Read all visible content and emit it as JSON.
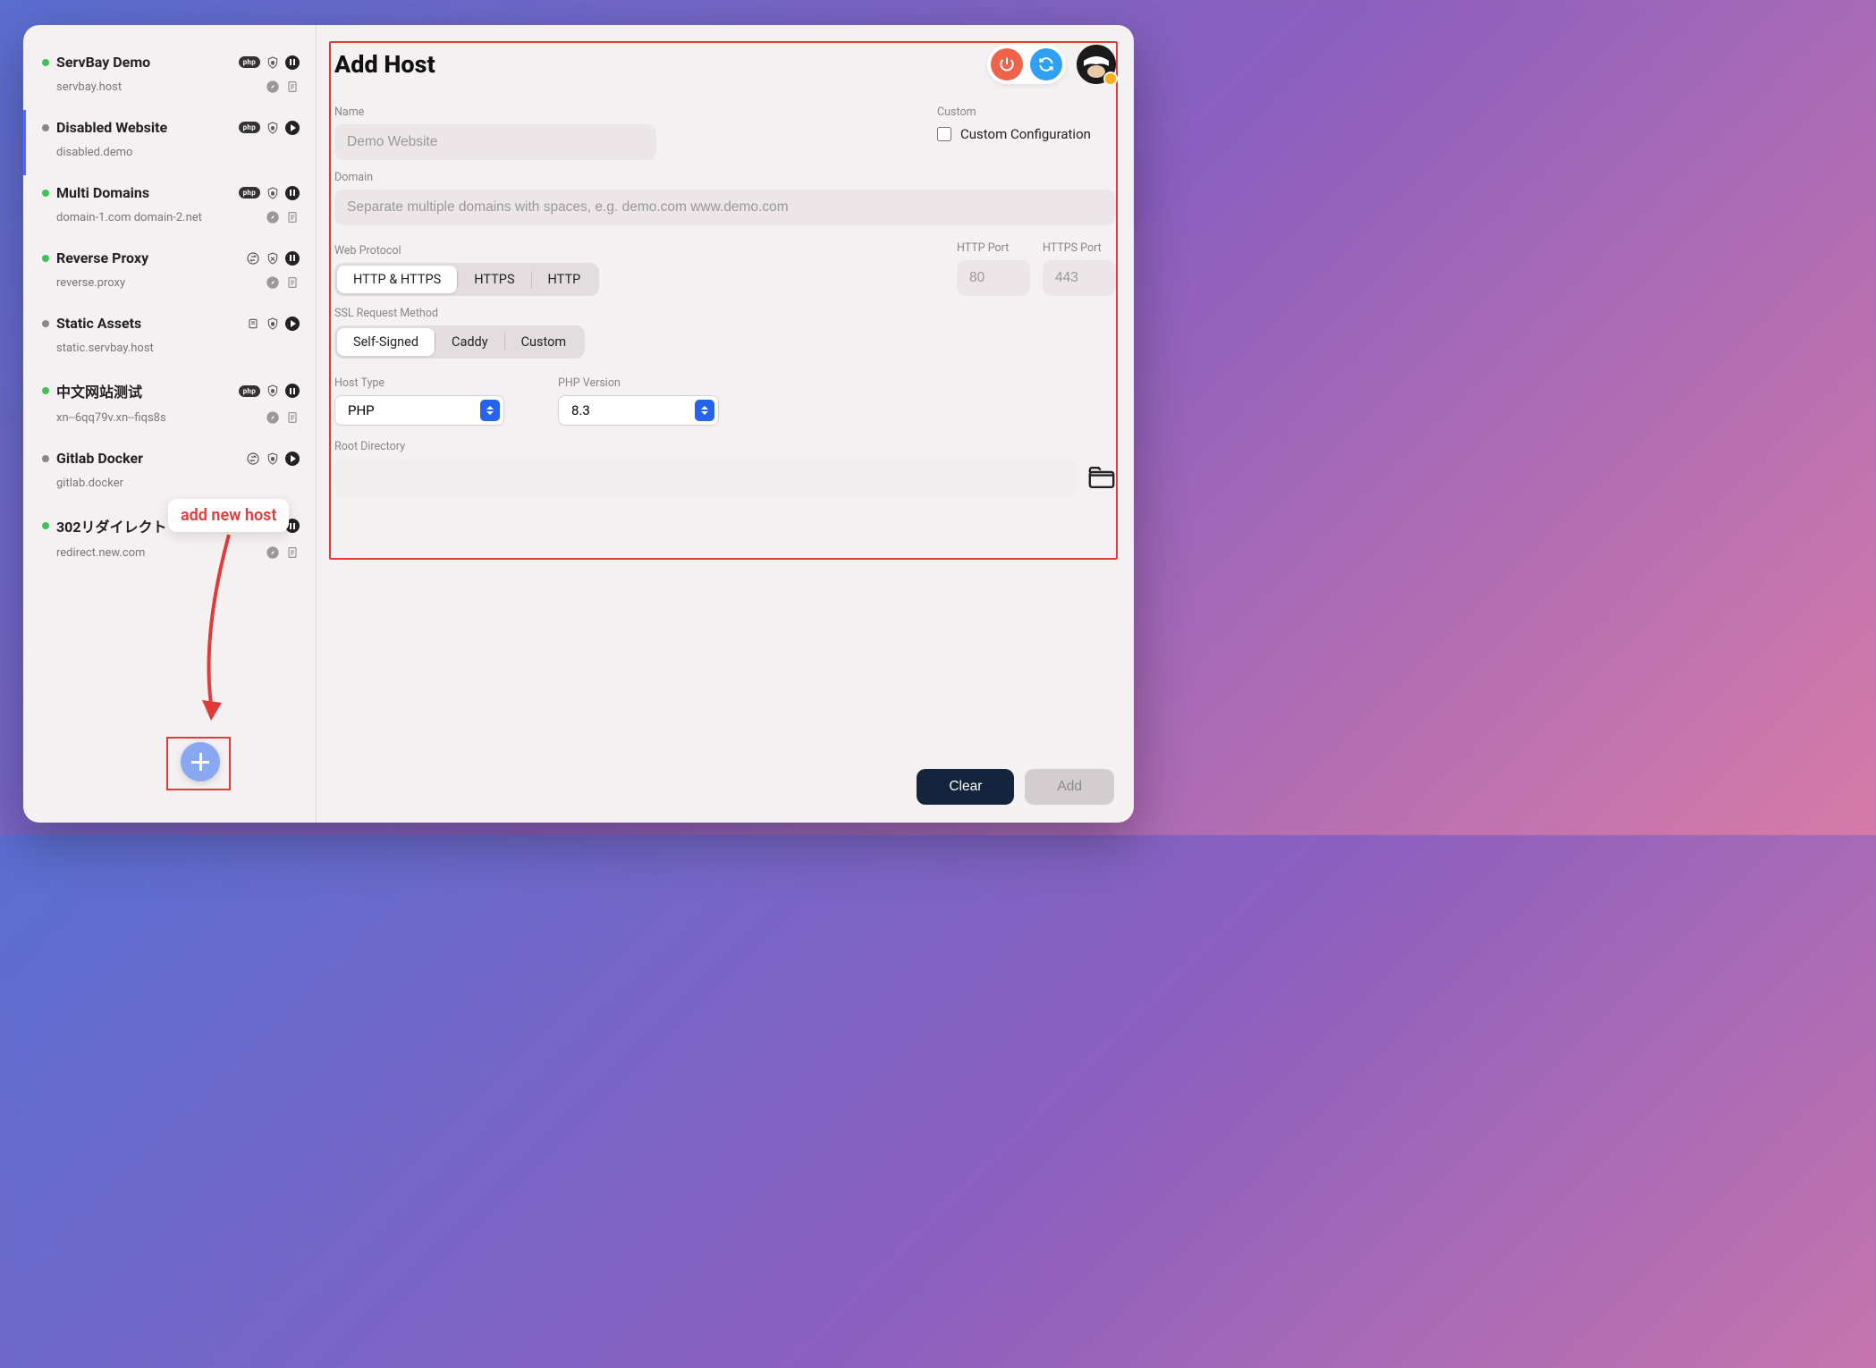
{
  "annotation": {
    "tooltip": "add new host"
  },
  "sidebar": {
    "items": [
      {
        "name": "ServBay Demo",
        "domain": "servbay.host",
        "status": "green",
        "tag": "php",
        "shield": "lock",
        "action": "pause",
        "row2a": "compass",
        "row2b": "doc"
      },
      {
        "name": "Disabled Website",
        "domain": "disabled.demo",
        "status": "grey",
        "tag": "php",
        "shield": "lock",
        "action": "play",
        "row2a": "blank",
        "row2b": "blank",
        "selected": true
      },
      {
        "name": "Multi Domains",
        "domain": "domain-1.com domain-2.net",
        "status": "green",
        "tag": "php",
        "shield": "lock",
        "action": "pause",
        "row2a": "compass",
        "row2b": "doc"
      },
      {
        "name": "Reverse Proxy",
        "domain": "reverse.proxy",
        "status": "green",
        "tag": "swap",
        "shield": "x",
        "action": "pause",
        "row2a": "compass",
        "row2b": "doc"
      },
      {
        "name": "Static Assets",
        "domain": "static.servbay.host",
        "status": "grey",
        "tag": "layers",
        "shield": "lock",
        "action": "play",
        "row2a": "blank",
        "row2b": "blank"
      },
      {
        "name": "中文网站测试",
        "domain": "xn--6qq79v.xn--fiqs8s",
        "status": "green",
        "tag": "php",
        "shield": "lock",
        "action": "pause",
        "row2a": "compass",
        "row2b": "doc"
      },
      {
        "name": "Gitlab Docker",
        "domain": "gitlab.docker",
        "status": "grey",
        "tag": "swap",
        "shield": "lock",
        "action": "play",
        "row2a": "blank",
        "row2b": "blank"
      },
      {
        "name": "302リダイレクト",
        "domain": "redirect.new.com",
        "status": "green",
        "tag": "redirect",
        "shield": "lock",
        "action": "pause",
        "row2a": "compass",
        "row2b": "doc"
      }
    ]
  },
  "main": {
    "title": "Add Host",
    "labels": {
      "name": "Name",
      "custom": "Custom",
      "custom_config": "Custom Configuration",
      "domain": "Domain",
      "web_protocol": "Web Protocol",
      "http_port": "HTTP Port",
      "https_port": "HTTPS Port",
      "ssl_method": "SSL Request Method",
      "host_type": "Host Type",
      "php_version": "PHP Version",
      "root_dir": "Root Directory"
    },
    "placeholders": {
      "name": "Demo Website",
      "domain": "Separate multiple domains with spaces, e.g. demo.com www.demo.com",
      "http_port": "80",
      "https_port": "443"
    },
    "protocol_options": [
      "HTTP & HTTPS",
      "HTTPS",
      "HTTP"
    ],
    "protocol_selected": "HTTP & HTTPS",
    "ssl_options": [
      "Self-Signed",
      "Caddy",
      "Custom"
    ],
    "ssl_selected": "Self-Signed",
    "host_type_value": "PHP",
    "php_version_value": "8.3",
    "buttons": {
      "clear": "Clear",
      "add": "Add"
    }
  }
}
